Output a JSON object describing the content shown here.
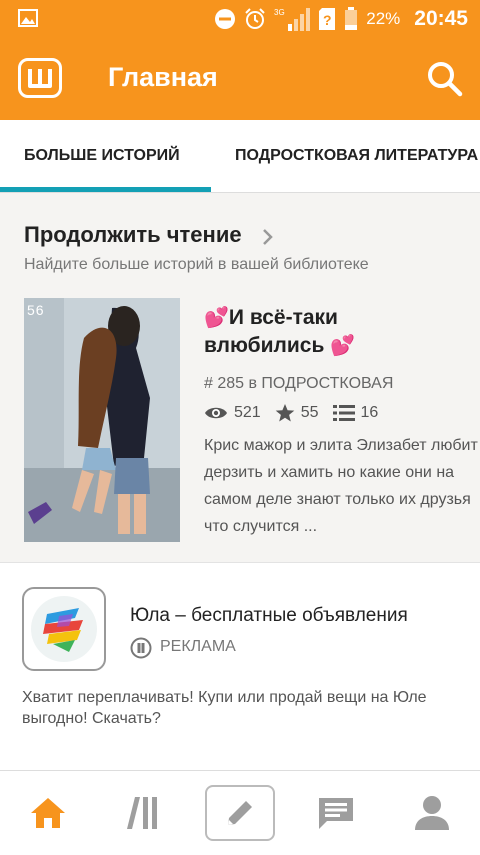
{
  "status_bar": {
    "battery": "22%",
    "time": "20:45",
    "network": "3G"
  },
  "app_bar": {
    "title": "Главная",
    "logo_letter": "Ш"
  },
  "tabs": [
    {
      "label": "БОЛЬШЕ ИСТОРИЙ",
      "active": true
    },
    {
      "label": "ПОДРОСТКОВАЯ ЛИТЕРАТУРА",
      "active": false
    }
  ],
  "continue_reading": {
    "title": "Продолжить чтение",
    "subtitle": "Найдите больше историй в вашей библиотеке",
    "book": {
      "cover_label": "56",
      "title_line1": "И  всё-таки",
      "title_line2": "влюбились",
      "rank": "# 285 в ПОДРОСТКОВАЯ",
      "reads": "521",
      "votes": "55",
      "parts": "16",
      "description": "Крис мажор и элита Элизабет любит дерзить и хамить но какие они на самом деле знают только их друзья что случится ..."
    }
  },
  "ad": {
    "title": "Юла – бесплатные объявления",
    "badge": "РЕКЛАМА",
    "description": "Хватит переплачивать! Купи или продай вещи на Юле выгодно! Скачать?"
  },
  "colors": {
    "brand": "#f7941d",
    "tab_indicator": "#13a0b5",
    "nav_active": "#f7941d",
    "nav_inactive": "#9e9e9e",
    "heart": "#e0559a"
  },
  "bottom_nav": [
    {
      "icon": "home-icon",
      "active": true
    },
    {
      "icon": "library-icon",
      "active": false
    },
    {
      "icon": "pencil-icon",
      "active": false
    },
    {
      "icon": "messages-icon",
      "active": false
    },
    {
      "icon": "profile-icon",
      "active": false
    }
  ]
}
